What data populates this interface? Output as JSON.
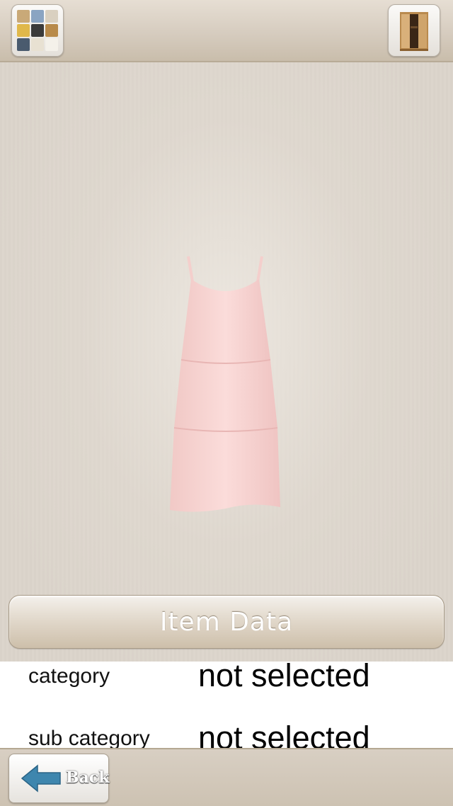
{
  "top_bar": {
    "gallery_icon": "gallery-grid-icon",
    "closet_icon": "wardrobe-icon"
  },
  "item_image": {
    "icon": "pink-dress-image",
    "color": "#f6d3d2"
  },
  "item_data_button": {
    "label": "Item Data"
  },
  "item_info": {
    "rows": [
      {
        "key": "category",
        "value": "not selected"
      },
      {
        "key": "sub category",
        "value": "not selected"
      }
    ]
  },
  "bottom_bar": {
    "back_label": "Back",
    "back_icon": "back-arrow-icon"
  }
}
